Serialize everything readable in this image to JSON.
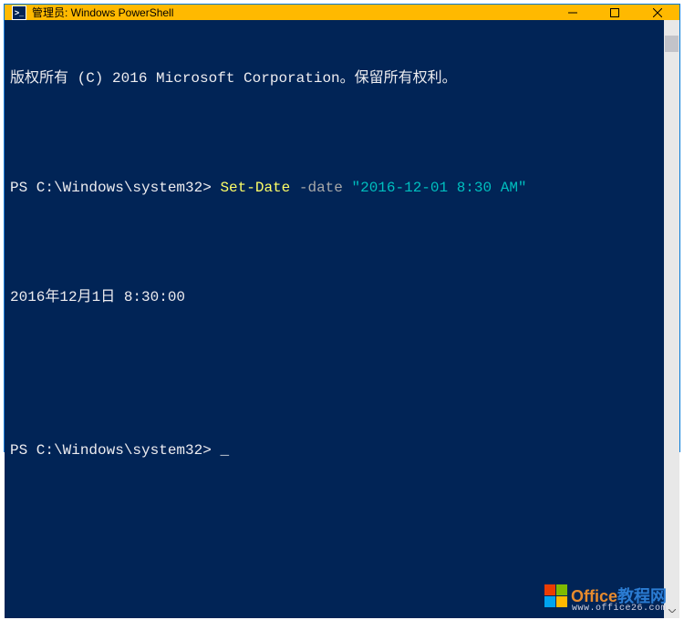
{
  "titlebar": {
    "icon_label": ">_",
    "title": "管理员: Windows PowerShell"
  },
  "terminal": {
    "line1": "版权所有 (C) 2016 Microsoft Corporation。保留所有权利。",
    "blank": "",
    "prompt1_prefix": "PS C:\\Windows\\system32> ",
    "prompt1_cmd": "Set-Date",
    "prompt1_space1": " ",
    "prompt1_param": "-date",
    "prompt1_space2": " ",
    "prompt1_arg": "\"2016-12-01 8:30 AM\"",
    "output1": "2016年12月1日 8:30:00",
    "prompt2": "PS C:\\Windows\\system32>",
    "cursor": " _"
  },
  "watermark": {
    "text_main": "Office",
    "text_cn": "教程网",
    "url": "www.office26.com",
    "colors": {
      "orange": "#eb3c00",
      "green": "#7fba00",
      "blue": "#00a4ef",
      "yellow": "#ffb900"
    }
  }
}
